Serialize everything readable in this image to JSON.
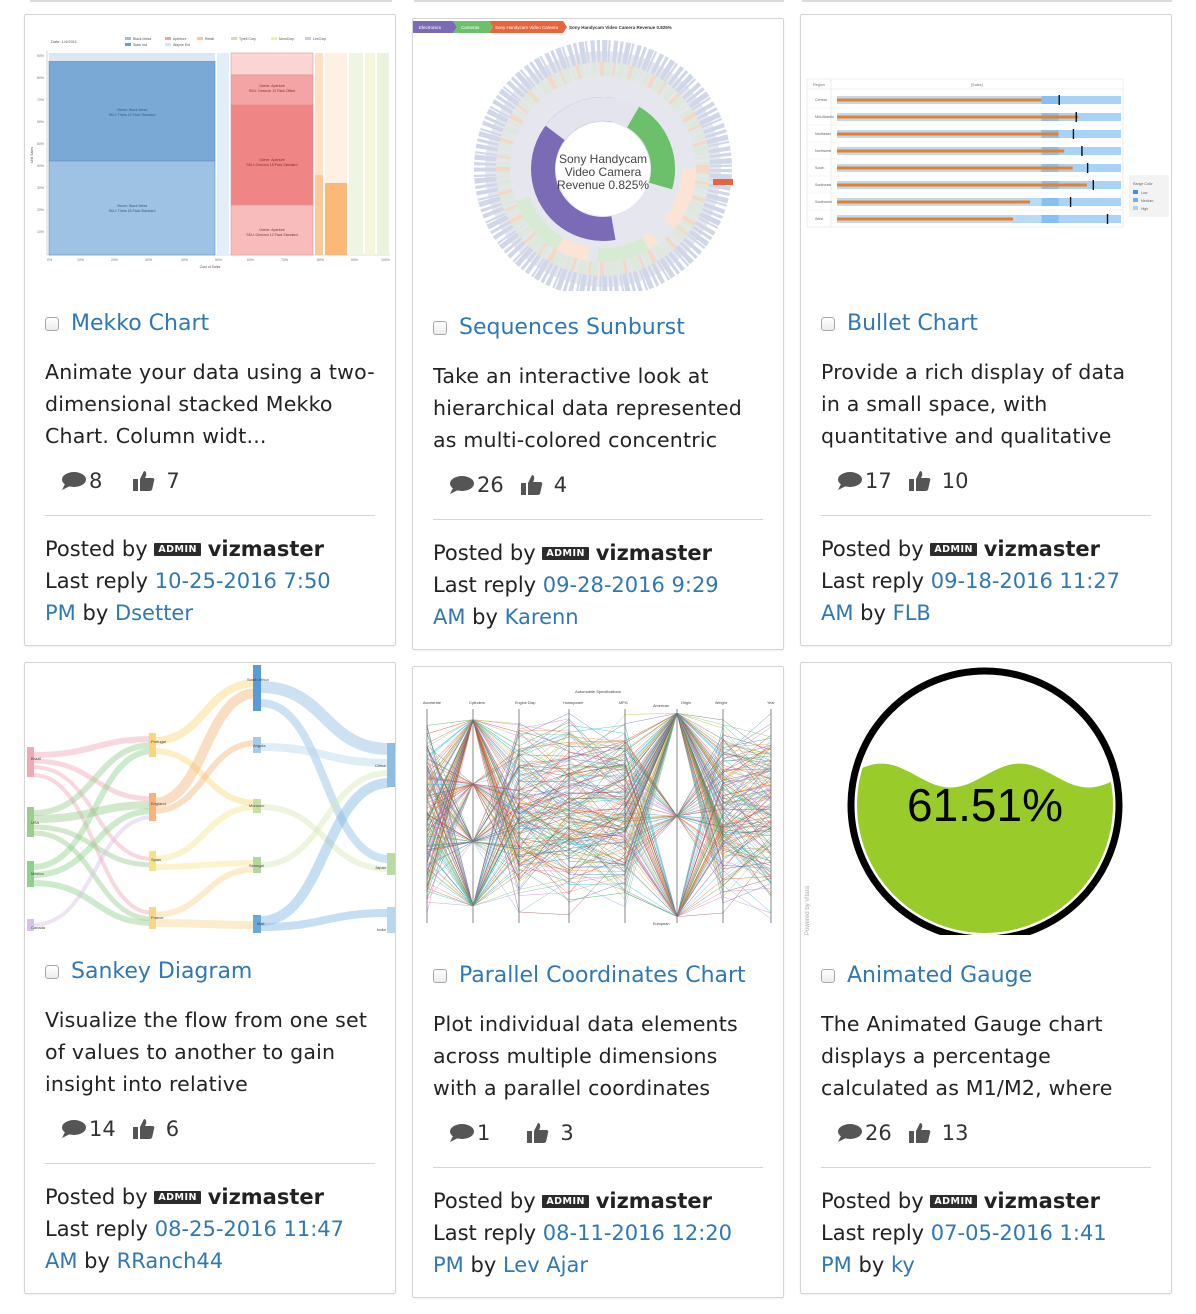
{
  "badge_label": "ADMIN",
  "posted_by_label": "Posted by",
  "last_reply_label": "Last reply",
  "by_label": "by",
  "cards": [
    {
      "title": "Mekko Chart",
      "description": "Animate your data using a two-dimensional stacked Mekko Chart.  Column widt...",
      "comments": "8",
      "likes": "7",
      "author": "vizmaster",
      "reply_date": "10-25-2016 7:50",
      "reply_time_suffix": "PM",
      "reply_user": "Dsetter",
      "thumb": {
        "date_label": "Date: 1/4/2011",
        "legend": [
          "Black Mesa",
          "Aperture",
          "Retail",
          "Tyrell Corp",
          "MomCorp",
          "LexCorp",
          "Stark Ind",
          "Wayne Ent"
        ],
        "cells": [
          [
            "Owner: Black Mesa",
            "SKU: Theta 12 Pack Standard"
          ],
          [
            "Owner: Black Mesa",
            "SKU: Theta 18 Pack Standard"
          ],
          [
            "Owner: Aperture",
            "SKU: Omicron 12 Pack Offset"
          ],
          [
            "Owner: Aperture",
            "SKU: Omicron 18 Pack Standard"
          ],
          [
            "Owner: Aperture",
            "SKU: Omicron 12 Pack Standard"
          ]
        ],
        "xlabel": "Cost of Sales",
        "ylabel": "Unit Sales"
      }
    },
    {
      "title": "Sequences Sunburst",
      "description": "Take an interactive look at hierarchical data represented as multi-colored concentric",
      "comments": "26",
      "likes": "4",
      "author": "vizmaster",
      "reply_date": "09-28-2016 9:29",
      "reply_time_suffix": "AM",
      "reply_user": "Karenn",
      "thumb": {
        "crumbs": [
          "Electronics",
          "Cameras",
          "Sony Handycam Video Camera"
        ],
        "crumb_caption": "Sony Handycam Video Camera Revenue 0.825%",
        "center_lines": [
          "Sony Handycam",
          "Video Camera",
          "Revenue 0.825%"
        ]
      }
    },
    {
      "title": "Bullet Chart",
      "description": "Provide a rich display of data in a small space, with quantitative and qualitative",
      "comments": "17",
      "likes": "10",
      "author": "vizmaster",
      "reply_date": "09-18-2016 11:27",
      "reply_time_suffix": "AM",
      "reply_user": "FLB",
      "thumb": {
        "col_header": "Region",
        "metric_header": "[Sales]",
        "rows": [
          "Central",
          "Mid-Atlantic",
          "Northeast",
          "Northwest",
          "South",
          "Southeast",
          "Southwest",
          "West"
        ],
        "legend_title": "Range Color",
        "legend": [
          "Low",
          "Medium",
          "High"
        ]
      }
    },
    {
      "title": "Sankey Diagram",
      "description": "Visualize the flow from one set of values to another to gain insight into relative",
      "comments": "14",
      "likes": "6",
      "author": "vizmaster",
      "reply_date": "08-25-2016 11:47",
      "reply_time_suffix": "AM",
      "reply_user": "RRanch44",
      "thumb": {
        "left": [
          "Brazil",
          "USA",
          "Mexico",
          "Canada"
        ],
        "mid": [
          "Portugal",
          "England",
          "Spain",
          "France"
        ],
        "right_mid": [
          "South Africa",
          "Angola",
          "Morocco",
          "Senegal",
          "Mali"
        ],
        "right": [
          "China",
          "Japan",
          "India"
        ]
      }
    },
    {
      "title": "Parallel Coordinates Chart",
      "description": "Plot individual data elements across multiple dimensions with a parallel coordinates",
      "comments": "1",
      "likes": "3",
      "author": "vizmaster",
      "reply_date": "08-11-2016 12:20",
      "reply_time_suffix": "PM",
      "reply_user": "Lev Ajar",
      "thumb": {
        "caption": "Automobile Specifications",
        "axes": [
          "Accelerate",
          "Cylinders",
          "Engine Disp",
          "Horsepower",
          "MPG",
          "Origin",
          "Weight",
          "Year"
        ],
        "origin_labels": [
          "American",
          "European"
        ]
      }
    },
    {
      "title": "Animated Gauge",
      "description": "The Animated Gauge chart displays a percentage calculated as M1/M2, where",
      "comments": "26",
      "likes": "13",
      "author": "vizmaster",
      "reply_date": "07-05-2016 1:41",
      "reply_time_suffix": "PM",
      "reply_user": "ky",
      "thumb": {
        "percent_label": "61.51%",
        "fill_fraction": 0.6151,
        "powered_by": "Powered by Vitara",
        "fill_color": "#99cc2a"
      }
    }
  ]
}
